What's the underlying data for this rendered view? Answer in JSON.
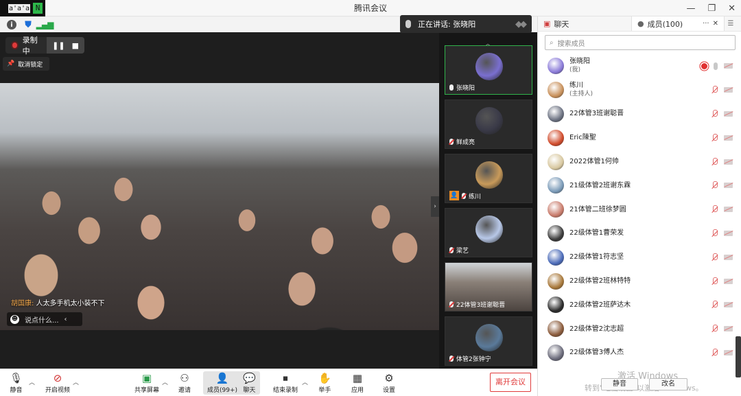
{
  "window": {
    "title": "腾讯会议",
    "logo_text": "a'a'a",
    "logo_mark": "N"
  },
  "speaker": {
    "label": "正在讲话: 张晓阳"
  },
  "recording": {
    "label": "录制中"
  },
  "pin": {
    "label": "取消锁定"
  },
  "stage": {
    "message_sender": "胡国康:",
    "message_text": " 人太多手机太小装不下",
    "chat_placeholder": "说点什么..."
  },
  "tiles": [
    {
      "name": "张晓阳",
      "active": true,
      "color": "#7a6fd0"
    },
    {
      "name": "鲜成亮",
      "color": "#3a3a48"
    },
    {
      "name": "练川",
      "host": true,
      "color": "#c89a5a"
    },
    {
      "name": "梁艺",
      "color": "#b8c8e8"
    },
    {
      "name": "22体管3班谢聪晋",
      "color": "#8a8078"
    },
    {
      "name": "体管2张钟宁",
      "color": "#5a7a9a"
    }
  ],
  "panel": {
    "tab_chat": "聊天",
    "tab_members": "成员(100)",
    "search_placeholder": "搜索成员",
    "members": [
      {
        "name": "张晓阳",
        "sub": "(我)",
        "color": "#8a7ad8",
        "recording": true
      },
      {
        "name": "练川",
        "sub": "(主持人)",
        "color": "#c8905a"
      },
      {
        "name": "22体管3班谢聪晋",
        "color": "#6a7080"
      },
      {
        "name": "Eric陳聖",
        "color": "#d04a2a"
      },
      {
        "name": "2022体管1何帅",
        "color": "#d8c8a0"
      },
      {
        "name": "21级体管2班谢东霖",
        "color": "#7a9ab8"
      },
      {
        "name": "21体管二班徐梦圆",
        "color": "#c87a6a"
      },
      {
        "name": "22级体管1曹荣发",
        "color": "#3a3a3a"
      },
      {
        "name": "22级体管1符志坚",
        "color": "#4a6ab8"
      },
      {
        "name": "22级体管2班林特特",
        "color": "#a8783a"
      },
      {
        "name": "22级体管2班萨达木",
        "color": "#2a2a2a"
      },
      {
        "name": "22级体管2沈志超",
        "color": "#8a5a3a"
      },
      {
        "name": "22级体管3傅人杰",
        "color": "#6a6a7a"
      }
    ],
    "btn_mute": "静音",
    "btn_rename": "改名",
    "watermark_line1": "激活 Windows",
    "watermark_line2": "转到\"电脑设置\"以激活 Windows。"
  },
  "toolbar": {
    "mute": "静音",
    "video": "开启视频",
    "share": "共享屏幕",
    "invite": "邀请",
    "members": "成员(99+)",
    "chat": "聊天",
    "stop_record": "结束录制",
    "raise_hand": "举手",
    "apps": "应用",
    "settings": "设置",
    "leave": "离开会议"
  }
}
